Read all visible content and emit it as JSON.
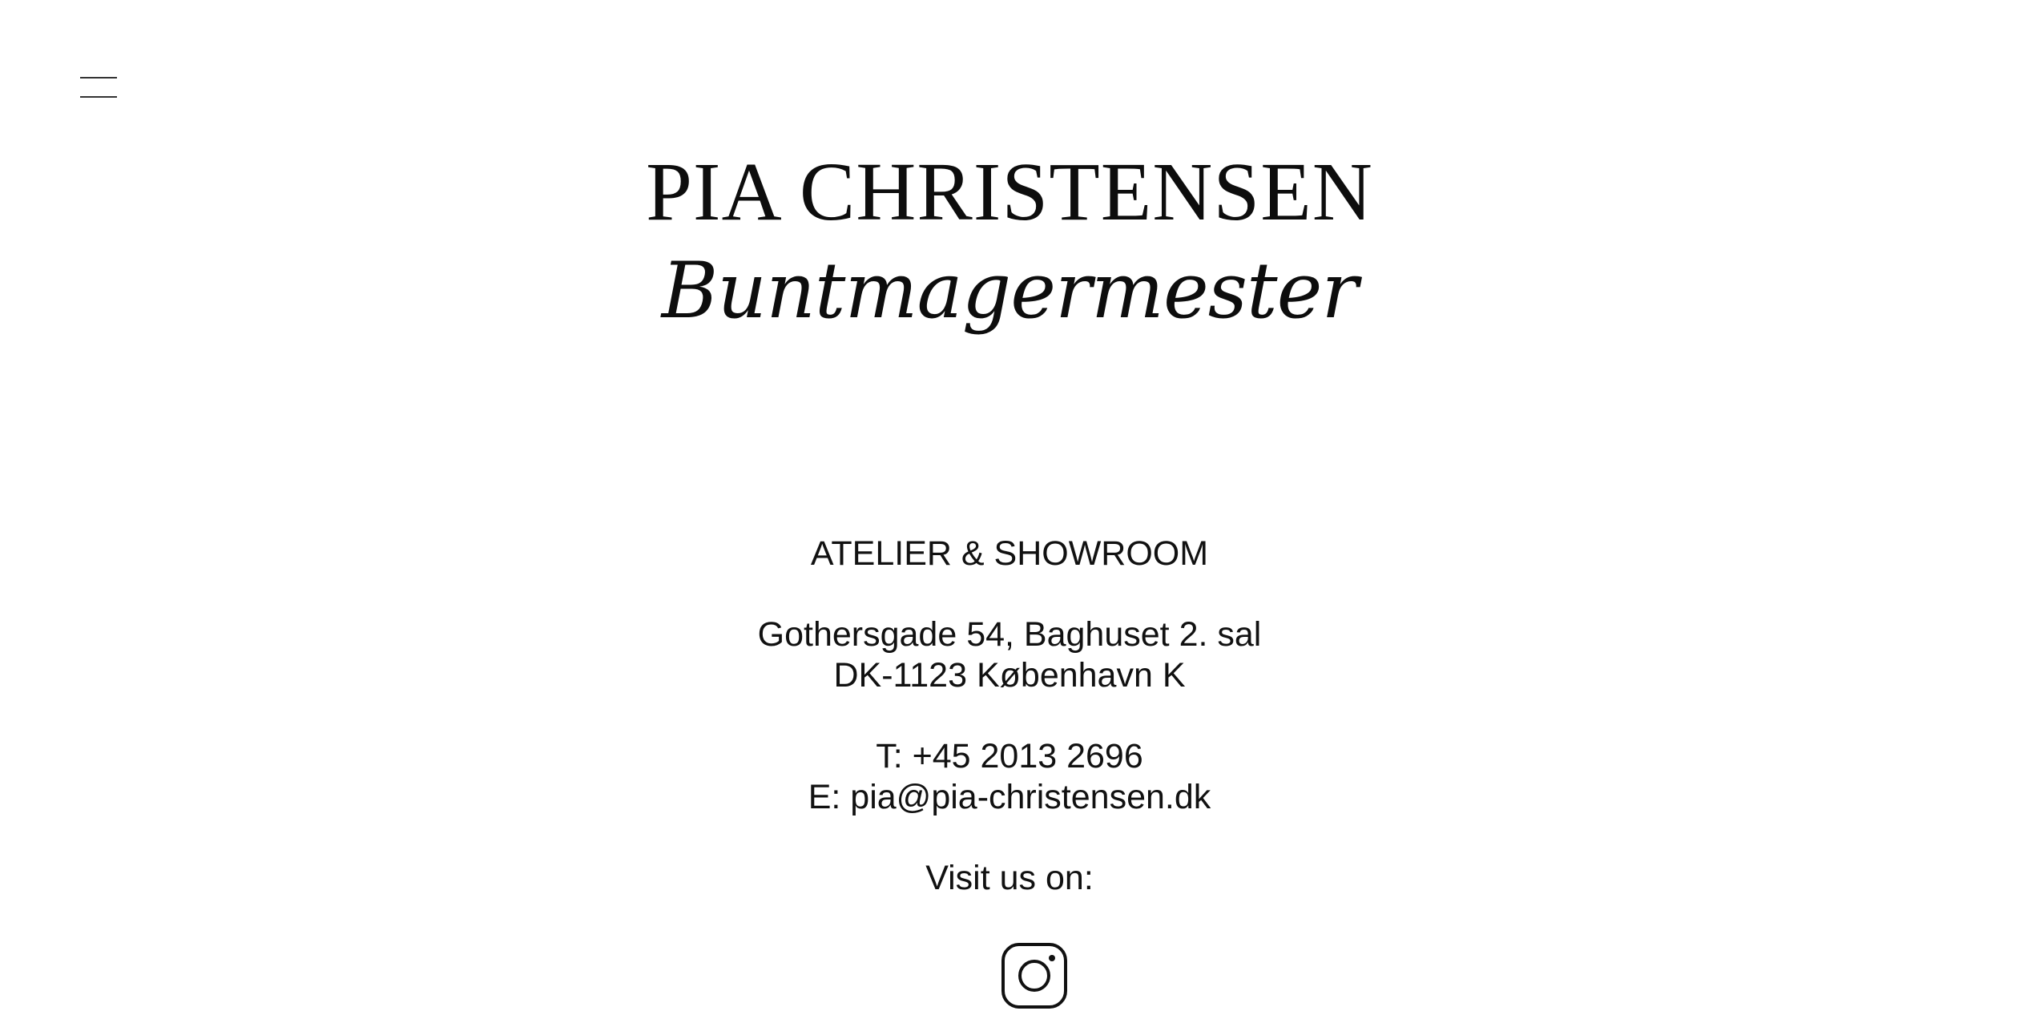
{
  "header": {
    "menu_icon": "hamburger-menu-icon",
    "brand_name": "PIA CHRISTENSEN",
    "brand_tagline": "Buntmagermester"
  },
  "contact": {
    "heading": "ATELIER & SHOWROOM",
    "address_line1": "Gothersgade 54, Baghuset 2. sal",
    "address_line2": "DK-1123 København K",
    "phone": "T: +45 2013 2696",
    "email_prefix": "E: ",
    "email": "pia@pia-christensen.dk",
    "visit_label": "Visit us on:",
    "social_icon": "instagram-icon"
  },
  "colors": {
    "background": "#ffffff",
    "text": "#111111"
  }
}
